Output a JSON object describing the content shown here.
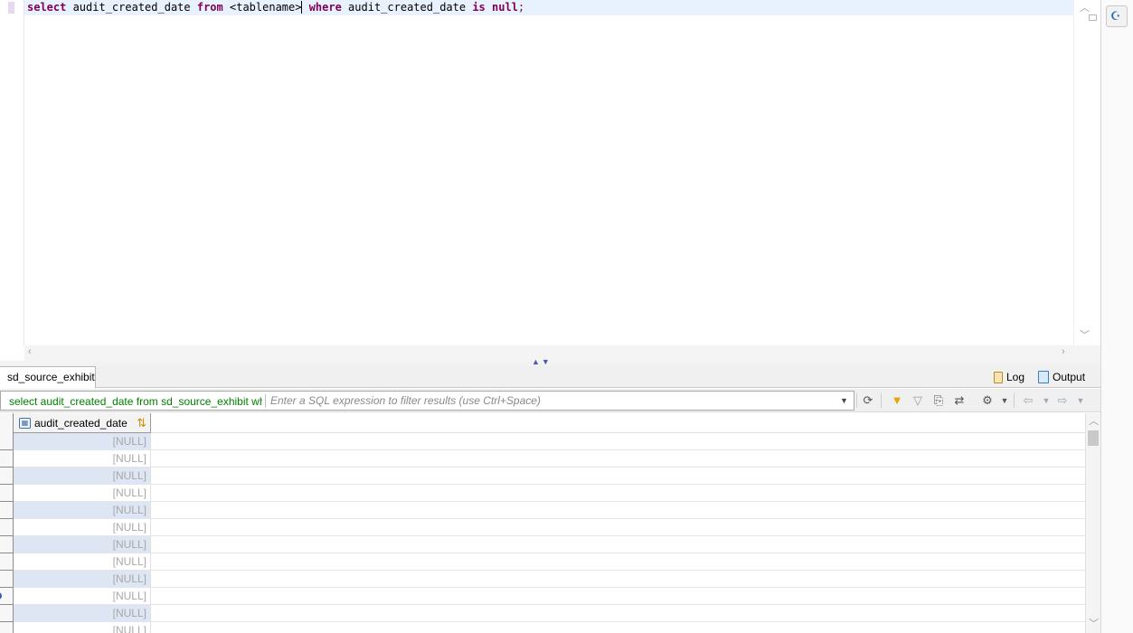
{
  "editor": {
    "sql": {
      "kw_select": "select",
      "col1": " audit_created_date ",
      "kw_from": "from",
      "table": " <tablename>",
      "kw_where": "where",
      "col2": " audit_created_date ",
      "kw_is": "is",
      "kw_null": "null",
      "semicolon": ";"
    }
  },
  "results": {
    "tab_label": "sd_source_exhibit",
    "log_label": "Log",
    "output_label": "Output",
    "query_text": "select audit_created_date from sd_source_exhibit where audit_created_date is null;",
    "filter_placeholder": "Enter a SQL expression to filter results (use Ctrl+Space)",
    "column_header": "audit_created_date",
    "rows": [
      "[NULL]",
      "[NULL]",
      "[NULL]",
      "[NULL]",
      "[NULL]",
      "[NULL]",
      "[NULL]",
      "[NULL]",
      "[NULL]",
      "[NULL]",
      "[NULL]",
      "[NULL]"
    ]
  },
  "icons": {
    "funnel": "filter-icon",
    "funnel_clear": "clear-filter-icon",
    "refresh": "refresh-icon",
    "back": "back-icon",
    "forward": "forward-icon"
  },
  "colors": {
    "keyword": "#7f0055",
    "query_text": "#008000",
    "null_value": "#a8a8a8",
    "selected_row": "#dde6f2"
  }
}
